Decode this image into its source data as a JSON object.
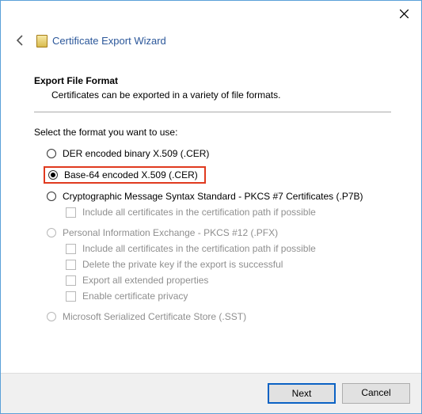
{
  "window": {
    "title": "Certificate Export Wizard"
  },
  "section": {
    "heading": "Export File Format",
    "subtitle": "Certificates can be exported in a variety of file formats."
  },
  "prompt": "Select the format you want to use:",
  "options": {
    "der": "DER encoded binary X.509 (.CER)",
    "base64": "Base-64 encoded X.509 (.CER)",
    "pkcs7": "Cryptographic Message Syntax Standard - PKCS #7 Certificates (.P7B)",
    "pkcs7_include": "Include all certificates in the certification path if possible",
    "pfx": "Personal Information Exchange - PKCS #12 (.PFX)",
    "pfx_include": "Include all certificates in the certification path if possible",
    "pfx_delete": "Delete the private key if the export is successful",
    "pfx_extended": "Export all extended properties",
    "pfx_privacy": "Enable certificate privacy",
    "sst": "Microsoft Serialized Certificate Store (.SST)"
  },
  "buttons": {
    "next": "Next",
    "cancel": "Cancel"
  }
}
